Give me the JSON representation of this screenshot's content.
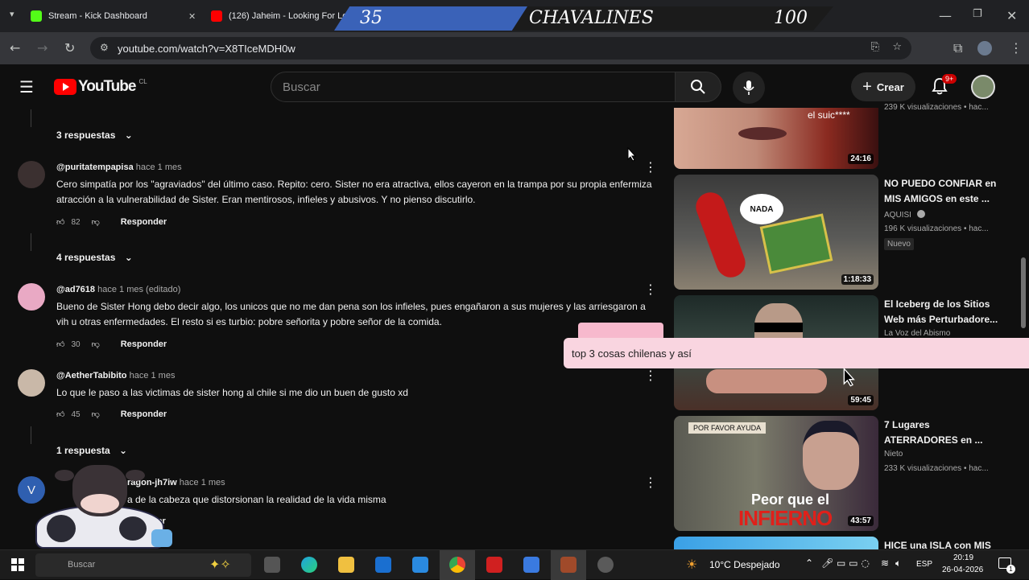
{
  "browser": {
    "tabs": [
      {
        "title": "Stream - Kick Dashboard"
      },
      {
        "title": "(126) Jaheim - Looking For Lo"
      }
    ],
    "url": "youtube.com/watch?v=X8TIceMDH0w"
  },
  "overlay": {
    "left_score": "35",
    "team_name": "CHAVALINES",
    "right_score": "100"
  },
  "youtube": {
    "logo": "YouTube",
    "country": "CL",
    "search_placeholder": "Buscar",
    "create_label": "Crear",
    "notif_count": "9+"
  },
  "comments": {
    "thread0_replies": "3 respuestas",
    "items": [
      {
        "handle": "@puritatempapisa",
        "time": "hace 1 mes",
        "text": "Cero simpatía por los \"agraviados\" del último caso. Repito: cero. Sister no era atractiva, ellos cayeron en la trampa por su propia enfermiza atracción a la vulnerabilidad de Sister. Eran mentirosos, infieles y abusivos. Y no pienso discutirlo.",
        "likes": "82",
        "reply": "Responder",
        "replies": "4 respuestas"
      },
      {
        "handle": "@ad7618",
        "time": "hace 1 mes (editado)",
        "text": "Bueno de Sister Hong debo decir algo, los unicos que no me dan pena son los infieles, pues engañaron a sus mujeres y las arriesgaron a vih u otras enfermedades. El resto si es turbio: pobre señorita y pobre señor de la comida.",
        "likes": "30",
        "reply": "Responder"
      },
      {
        "handle": "@AetherTabibito",
        "time": "hace 1 mes",
        "text": "Lo que le paso a las victimas de sister hong al chile si me dio un buen de gusto xd",
        "likes": "45",
        "reply": "Responder",
        "replies": "1 respuesta"
      },
      {
        "handle": "ragon-jh7iw",
        "time": "hace 1 mes",
        "text": "a de la cabeza que distorsionan la realidad de la vida misma",
        "reply": "nder",
        "avatar_letter": "V"
      }
    ]
  },
  "sidebar": {
    "videos": [
      {
        "thumb_text": "el suic****",
        "duration": "24:16",
        "views": "239 K visualizaciones • hac..."
      },
      {
        "title": "NO PUEDO CONFIAR en MIS AMIGOS en este ...",
        "channel": "AQUISI",
        "views": "196 K visualizaciones • hac...",
        "badge": "Nuevo",
        "duration": "1:18:33",
        "thumb_text": "NADA"
      },
      {
        "title": "El Iceberg de los Sitios Web más Perturbadore...",
        "channel": "La Voz del Abismo",
        "duration": "59:45"
      },
      {
        "title": "7 Lugares ATERRADORES en ...",
        "channel": "Nieto",
        "views": "233 K visualizaciones • hac...",
        "duration": "43:57",
        "thumb_top": "POR FAVOR AYUDA",
        "thumb_text1": "Peor que el",
        "thumb_text2": "INFIERNO"
      },
      {
        "title": "HICE una ISLA con MIS"
      }
    ]
  },
  "chat": {
    "message": "top 3 cosas chilenas y así"
  },
  "taskbar": {
    "weather": "10°C  Despejado",
    "lang": "ESP",
    "time": "20:19",
    "date": "26-04-2026",
    "notif": "1",
    "search_text": "Buscar"
  }
}
